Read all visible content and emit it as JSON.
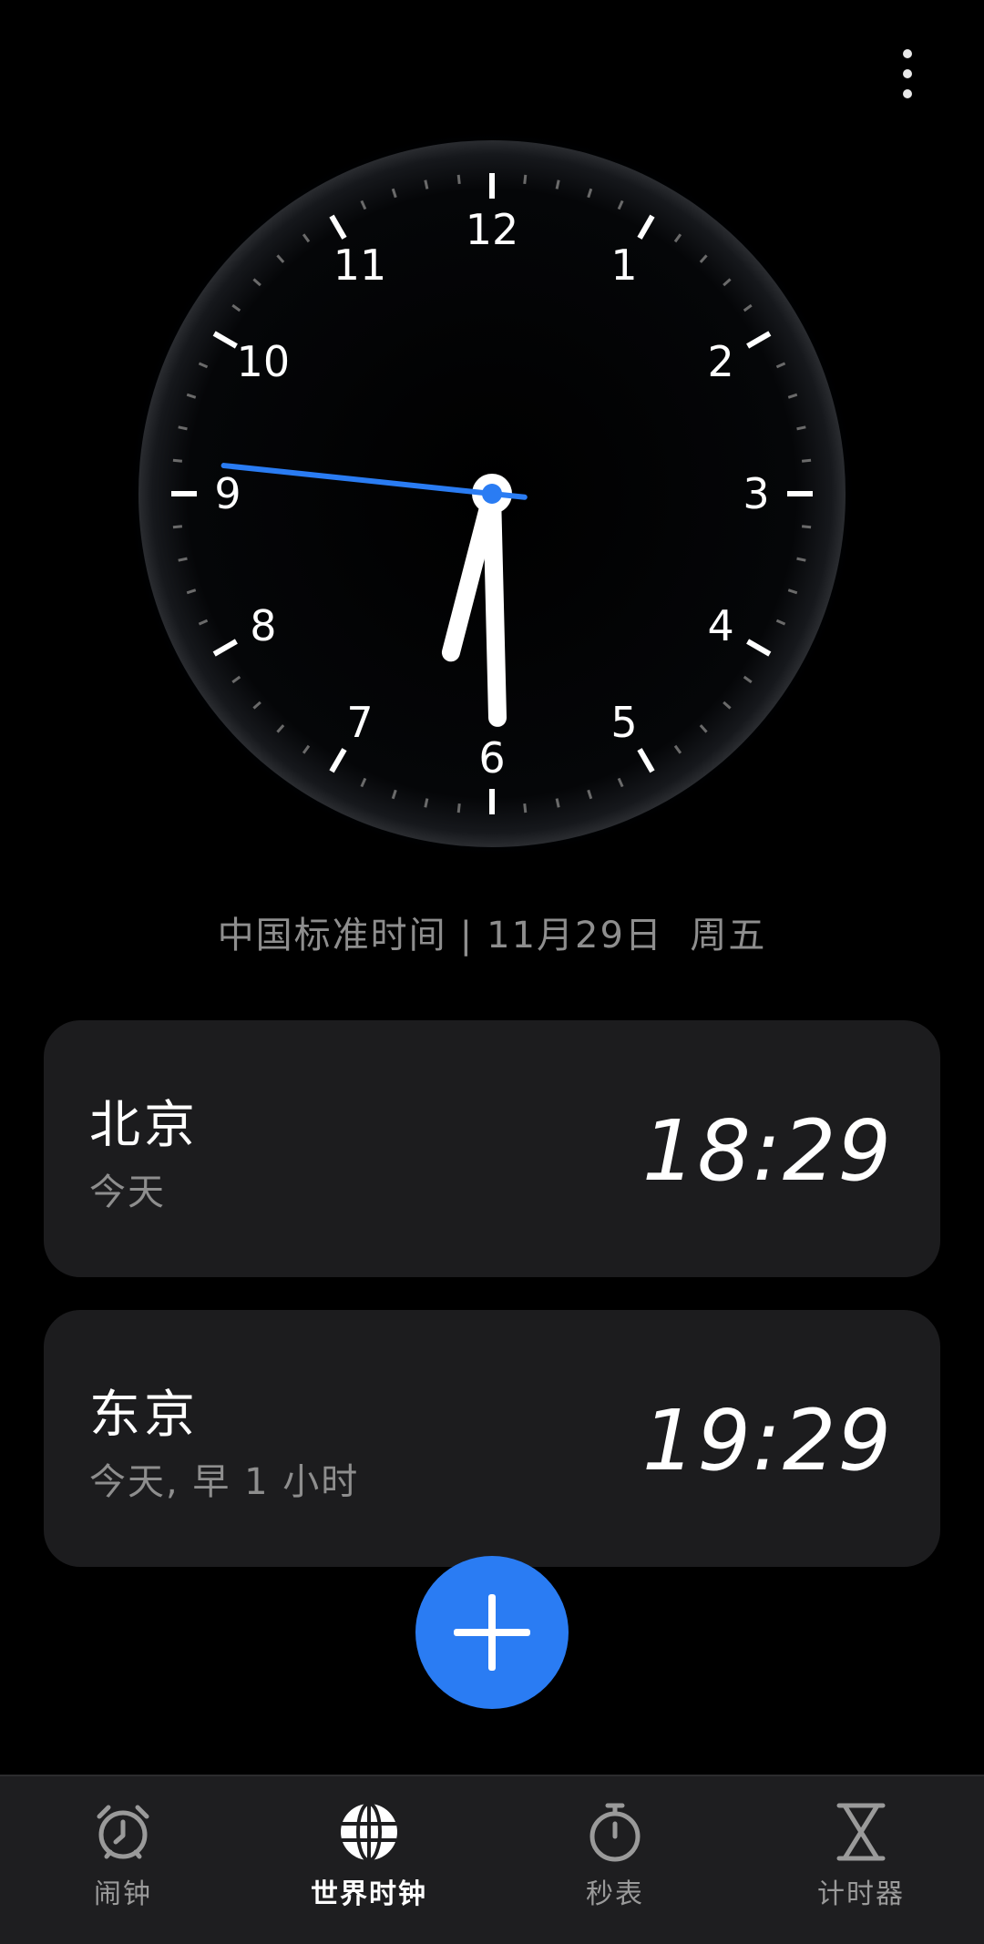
{
  "colors": {
    "background": "#000000",
    "card": "#1c1c1e",
    "accent": "#2a7cf3",
    "secondary_text": "#8e8e8e",
    "tab_bar": "#1e1e20"
  },
  "top_bar": {
    "menu_icon": "more-vertical-icon"
  },
  "clock": {
    "numerals": [
      "12",
      "1",
      "2",
      "3",
      "4",
      "5",
      "6",
      "7",
      "8",
      "9",
      "10",
      "11"
    ],
    "time": {
      "hour": 6,
      "minute": 29,
      "second": 46
    }
  },
  "date_line": {
    "zone": "中国标准时间",
    "separator": "|",
    "date": "11月29日",
    "weekday": "周五"
  },
  "cities": [
    {
      "name": "北京",
      "relative": "今天",
      "time": "18:29"
    },
    {
      "name": "东京",
      "relative": "今天, 早 1 小时",
      "time": "19:29"
    }
  ],
  "fab": {
    "icon": "plus-icon"
  },
  "tabs": [
    {
      "label": "闹钟",
      "icon": "alarm-clock-icon",
      "active": false
    },
    {
      "label": "世界时钟",
      "icon": "globe-icon",
      "active": true
    },
    {
      "label": "秒表",
      "icon": "stopwatch-icon",
      "active": false
    },
    {
      "label": "计时器",
      "icon": "hourglass-icon",
      "active": false
    }
  ]
}
